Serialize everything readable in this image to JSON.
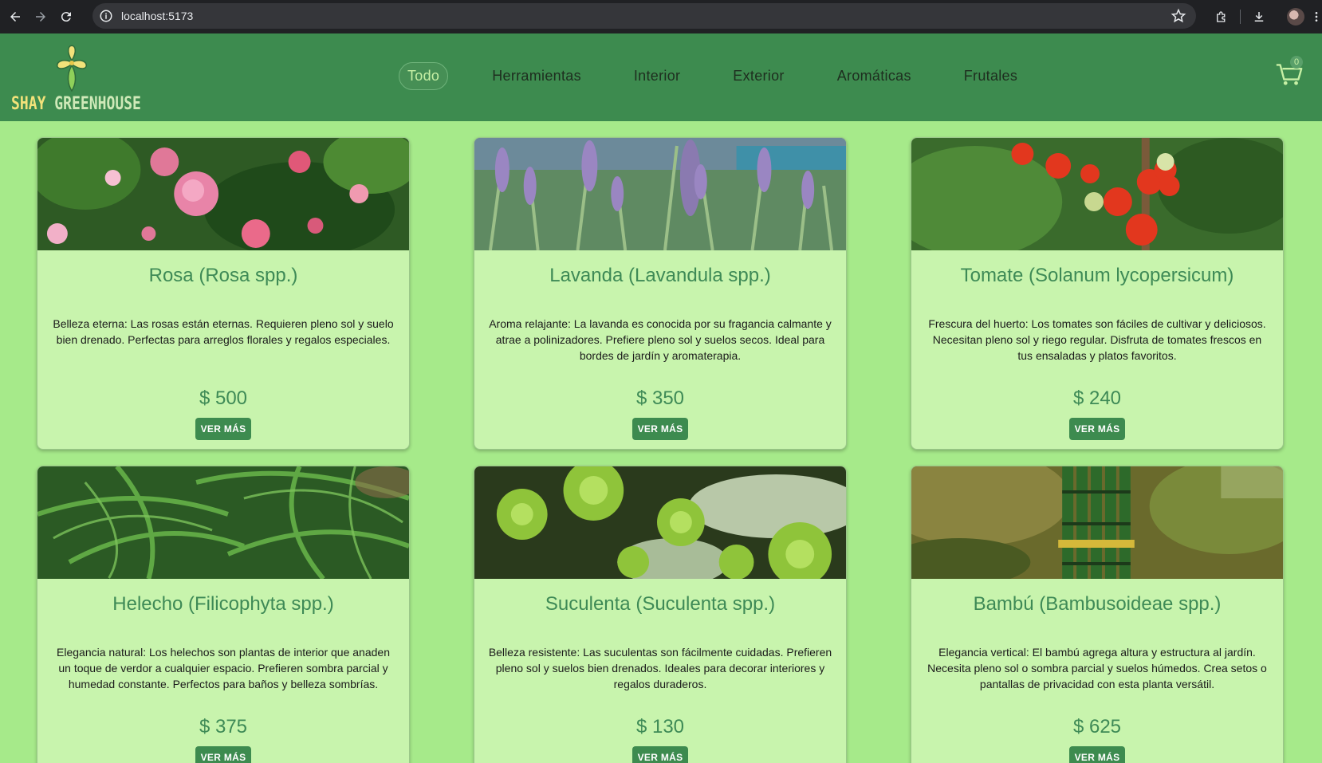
{
  "browser": {
    "url": "localhost:5173"
  },
  "header": {
    "logo_word1": "SHAY",
    "logo_word2": "GREENHOUSE",
    "nav": [
      {
        "label": "Todo",
        "active": true
      },
      {
        "label": "Herramientas",
        "active": false
      },
      {
        "label": "Interior",
        "active": false
      },
      {
        "label": "Exterior",
        "active": false
      },
      {
        "label": "Aromáticas",
        "active": false
      },
      {
        "label": "Frutales",
        "active": false
      }
    ],
    "cart_count": "0"
  },
  "products": [
    {
      "title": "Rosa (Rosa spp.)",
      "description": "Belleza eterna: Las rosas están eternas. Requieren pleno sol y suelo bien drenado. Perfectas para arreglos florales y regalos especiales.",
      "price": "$ 500",
      "button": "VER MÁS",
      "image": "roses-image"
    },
    {
      "title": "Lavanda (Lavandula spp.)",
      "description": "Aroma relajante: La lavanda es conocida por su fragancia calmante y atrae a polinizadores. Prefiere pleno sol y suelos secos. Ideal para bordes de jardín y aromaterapia.",
      "price": "$ 350",
      "button": "VER MÁS",
      "image": "lavender-image"
    },
    {
      "title": "Tomate (Solanum lycopersicum)",
      "description": "Frescura del huerto: Los tomates son fáciles de cultivar y deliciosos. Necesitan pleno sol y riego regular. Disfruta de tomates frescos en tus ensaladas y platos favoritos.",
      "price": "$ 240",
      "button": "VER MÁS",
      "image": "tomato-image"
    },
    {
      "title": "Helecho (Filicophyta spp.)",
      "description": "Elegancia natural: Los helechos son plantas de interior que anaden un toque de verdor a cualquier espacio. Prefieren sombra parcial y humedad constante. Perfectos para baños y belleza sombrías.",
      "price": "$ 375",
      "button": "VER MÁS",
      "image": "fern-image"
    },
    {
      "title": "Suculenta (Suculenta spp.)",
      "description": "Belleza resistente: Las suculentas son fácilmente cuidadas. Prefieren pleno sol y suelos bien drenados. Ideales para decorar interiores y regalos duraderos.",
      "price": "$ 130",
      "button": "VER MÁS",
      "image": "succulent-image"
    },
    {
      "title": "Bambú (Bambusoideae spp.)",
      "description": "Elegancia vertical: El bambú agrega altura y estructura al jardín. Necesita pleno sol o sombra parcial y suelos húmedos. Crea setos o pantallas de privacidad con esta planta versátil.",
      "price": "$ 625",
      "button": "VER MÁS",
      "image": "bamboo-image"
    }
  ]
}
